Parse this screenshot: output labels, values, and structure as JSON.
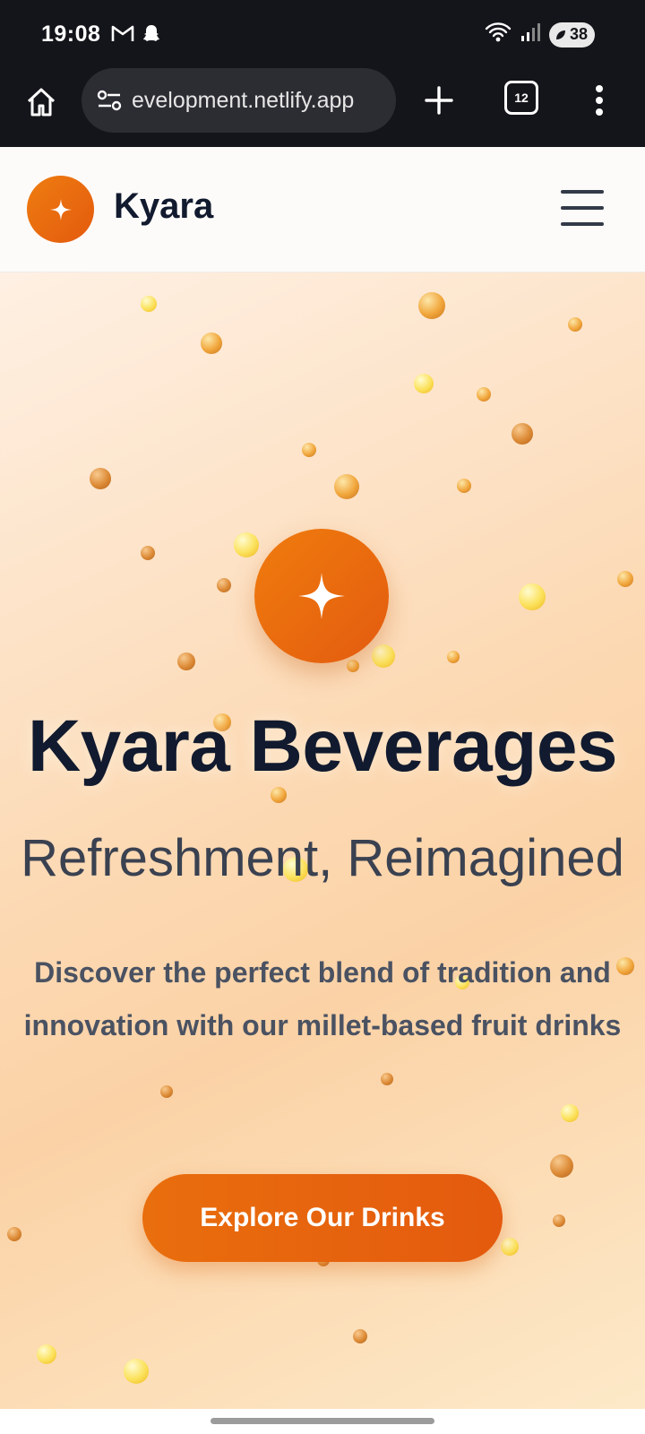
{
  "status_bar": {
    "time": "19:08",
    "battery": "38",
    "icons": [
      "gmail-icon",
      "snapchat-icon",
      "wifi-icon",
      "signal-icon",
      "battery-icon"
    ]
  },
  "browser": {
    "url": "evelopment.netlify.app",
    "tab_count": "12",
    "icons": [
      "home-icon",
      "site-settings-icon",
      "new-tab-icon",
      "tab-switcher-icon",
      "more-menu-icon"
    ]
  },
  "header": {
    "brand": "Kyara",
    "icons": [
      "sparkle-icon",
      "hamburger-menu-icon"
    ]
  },
  "hero": {
    "title": "Kyara Beverages",
    "subtitle": "Refreshment, Reimagined",
    "description": "Discover the perfect blend of tradition and innovation with our millet-based fruit drinks",
    "cta_label": "Explore Our Drinks"
  },
  "colors": {
    "accent": "#e8670e",
    "brand_text": "#111a2e",
    "status_bar_bg": "#14151a"
  }
}
